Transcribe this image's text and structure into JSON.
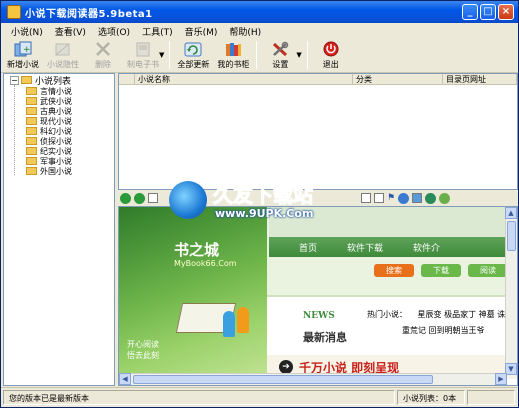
{
  "window": {
    "title": "小说下载阅读器5.9beta1"
  },
  "menu": [
    "小说(N)",
    "查看(V)",
    "选项(O)",
    "工具(T)",
    "音乐(M)",
    "帮助(H)"
  ],
  "toolbar": {
    "new_novel": "新增小说",
    "novel_hide": "小说隐性",
    "delete": "删除",
    "make_ebook": "制电子书",
    "update_all": "全部更新",
    "my_bookshelf": "我的书柜",
    "settings": "设置",
    "exit": "退出"
  },
  "tree": {
    "root": "小说列表",
    "children": [
      "言情小说",
      "武侠小说",
      "古典小说",
      "现代小说",
      "科幻小说",
      "侦探小说",
      "纪实小说",
      "军事小说",
      "外国小说"
    ]
  },
  "list": {
    "columns": [
      "小说名称",
      "分类",
      "目录页网址"
    ]
  },
  "browser": {
    "site_name": "书之城",
    "site_url": "MyBook66.Com",
    "tagline": [
      "开心阅读",
      "悟去此刻"
    ],
    "nav": [
      "首页",
      "软件下载",
      "软件介"
    ],
    "buttons": [
      "搜索",
      "下载",
      "阅读"
    ],
    "news_en": "NEWS",
    "news_cn": "最新消息",
    "hot_label": "热门小说：",
    "hot_items_1": "星辰变  极品家丁  神墓 诛",
    "hot_items_2": "重荒记  回到明朝当王爷",
    "banner": "千万小说 即刻呈现"
  },
  "watermark": {
    "cn": "久友下载站",
    "url": "www.9UPK.Com"
  },
  "status": {
    "message": "您的版本已是最新版本",
    "novel_count": "小说列表：0本"
  }
}
